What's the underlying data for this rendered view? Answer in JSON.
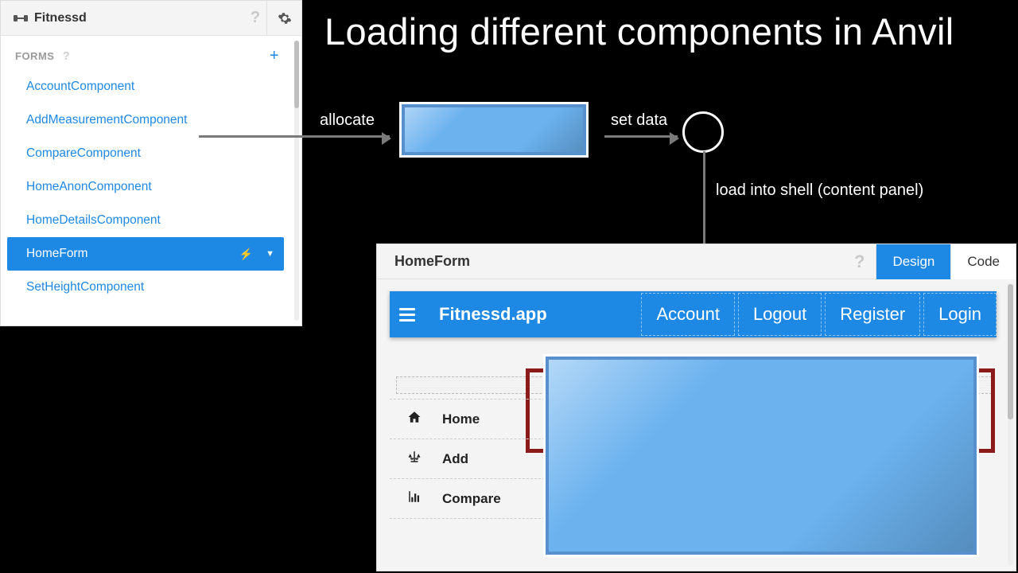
{
  "slide": {
    "title": "Loading different components in Anvil"
  },
  "diagram": {
    "allocate_label": "allocate",
    "setdata_label": "set data",
    "loadshell_label": "load into shell (content panel)"
  },
  "left_panel": {
    "app_name": "Fitnessd",
    "section_label": "FORMS",
    "items": [
      {
        "label": "AccountComponent",
        "selected": false
      },
      {
        "label": "AddMeasurementComponent",
        "selected": false
      },
      {
        "label": "CompareComponent",
        "selected": false
      },
      {
        "label": "HomeAnonComponent",
        "selected": false
      },
      {
        "label": "HomeDetailsComponent",
        "selected": false
      },
      {
        "label": "HomeForm",
        "selected": true
      },
      {
        "label": "SetHeightComponent",
        "selected": false
      }
    ]
  },
  "designer": {
    "form_title": "HomeForm",
    "tabs": {
      "design": "Design",
      "code": "Code",
      "active": "design"
    },
    "topnav": {
      "brand": "Fitnessd.app",
      "items": [
        "Account",
        "Logout",
        "Register",
        "Login"
      ]
    },
    "side_menu": [
      {
        "icon": "home",
        "label": "Home"
      },
      {
        "icon": "scales",
        "label": "Add"
      },
      {
        "icon": "bars",
        "label": "Compare"
      }
    ]
  }
}
